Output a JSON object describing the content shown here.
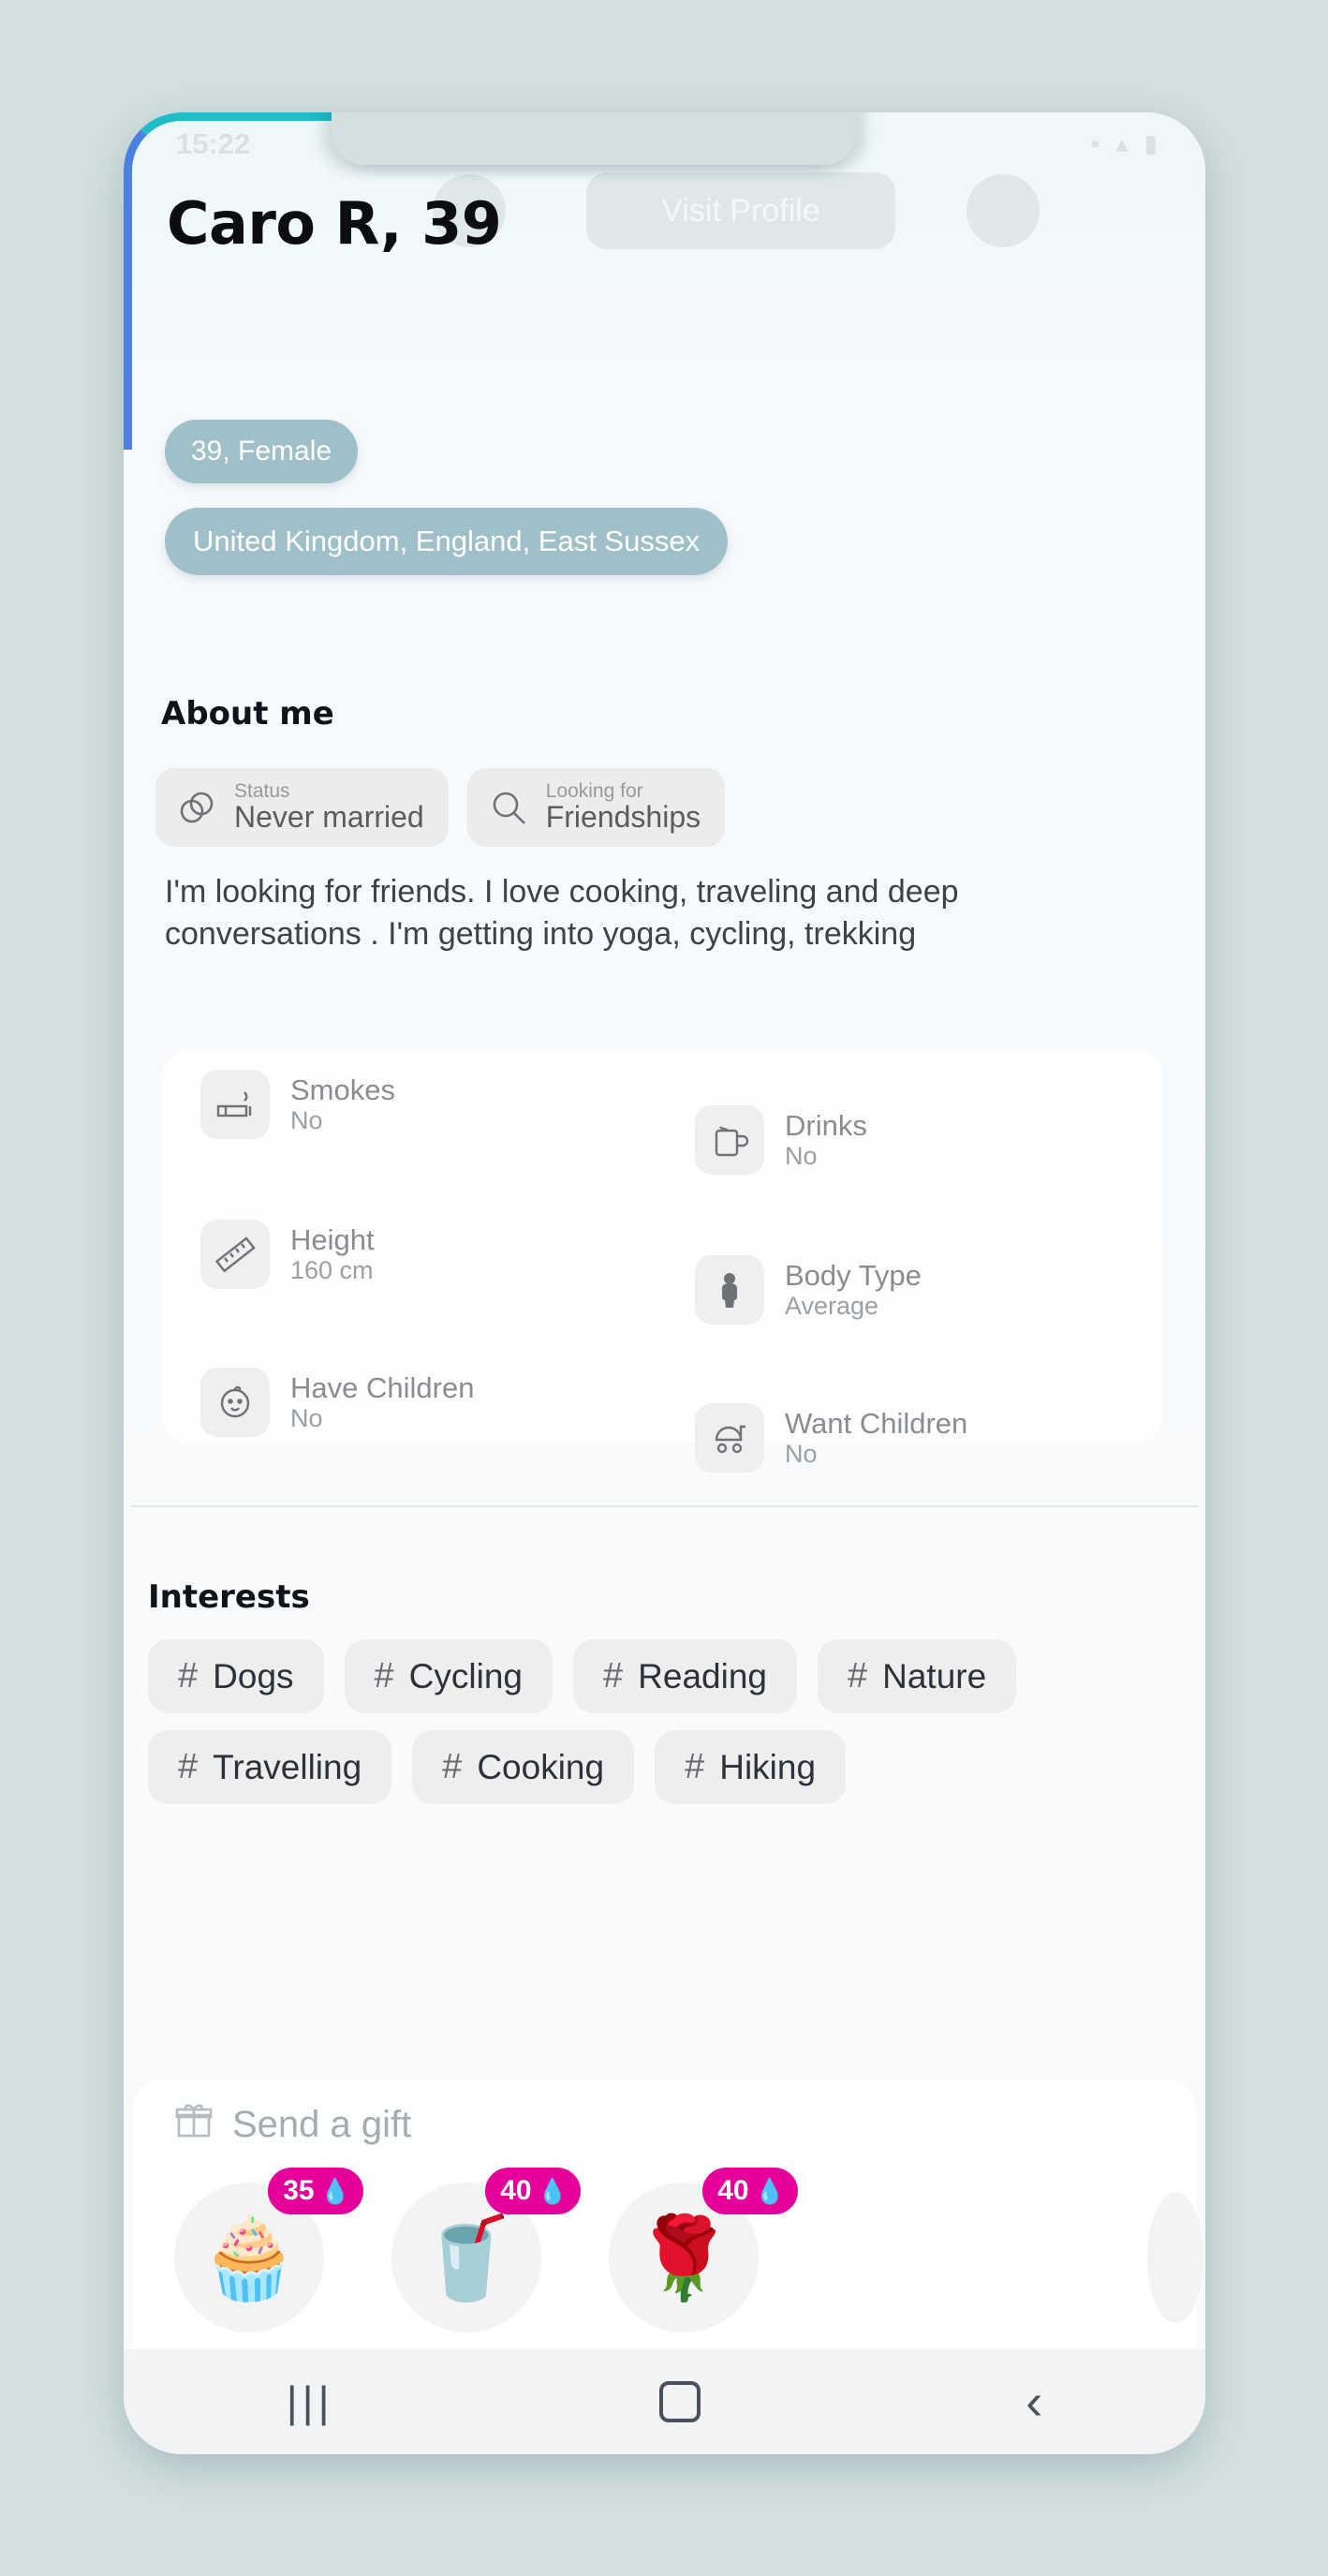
{
  "statusbar": {
    "time": "15:22",
    "icons": "▪ ▴ ▮"
  },
  "header": {
    "visit_profile_label": "Visit Profile",
    "back_icon": "back-arrow",
    "info_icon": "info"
  },
  "profile": {
    "name_age": "Caro R, 39",
    "age_gender_pill": "39, Female",
    "location_pill": "United Kingdom, England, East Sussex",
    "pill_color": "#9fc0c8"
  },
  "about": {
    "title": "About me",
    "chips": [
      {
        "icon": "rings-icon",
        "label": "Status",
        "value": "Never married"
      },
      {
        "icon": "magnifier-icon",
        "label": "Looking for",
        "value": "Friendships"
      }
    ],
    "bio": "I'm looking for friends. I love cooking, traveling and deep conversations . I'm getting into yoga, cycling, trekking"
  },
  "attributes": [
    {
      "icon": "cigarette-icon",
      "key": "Smokes",
      "value": "No"
    },
    {
      "icon": "beer-mug-icon",
      "key": "Drinks",
      "value": "No"
    },
    {
      "icon": "ruler-icon",
      "key": "Height",
      "value": "160 cm"
    },
    {
      "icon": "body-icon",
      "key": "Body Type",
      "value": "Average"
    },
    {
      "icon": "baby-face-icon",
      "key": "Have Children",
      "value": "No"
    },
    {
      "icon": "stroller-icon",
      "key": "Want Children",
      "value": "No"
    }
  ],
  "interests": {
    "title": "Interests",
    "tags": [
      "Dogs",
      "Cycling",
      "Reading",
      "Nature",
      "Travelling",
      "Cooking",
      "Hiking"
    ],
    "hash": "#"
  },
  "gifts": {
    "title": "Send a gift",
    "title_icon": "gift-icon",
    "items": [
      {
        "emoji": "🧁",
        "price": "35",
        "currency_icon": "💧"
      },
      {
        "emoji": "🥤",
        "price": "40",
        "currency_icon": "💧"
      },
      {
        "emoji": "🌹",
        "price": "40",
        "currency_icon": "💧"
      }
    ],
    "badge_color": "#e5009c"
  },
  "navbar": {
    "recents": "|||",
    "home": "home-square",
    "back": "‹"
  }
}
